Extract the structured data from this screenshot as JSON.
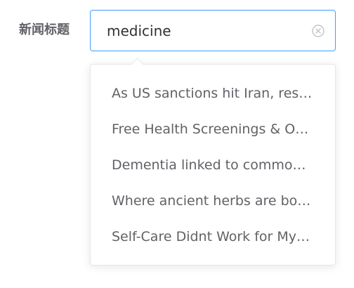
{
  "form": {
    "label": "新闻标题",
    "search": {
      "value": "medicine",
      "placeholder": ""
    }
  },
  "suggestions": [
    "As US sanctions hit Iran, res…",
    "Free Health Screenings & O…",
    "Dementia linked to commonl…",
    "Where ancient herbs are bo…",
    "Self-Care Didnt Work for My …"
  ],
  "colors": {
    "accent": "#409eff",
    "label_text": "#606266",
    "input_text": "#303133",
    "border": "#e4e7ed",
    "clear_icon": "#c0c4cc"
  },
  "icons": {
    "clear": "circle-close-icon"
  }
}
